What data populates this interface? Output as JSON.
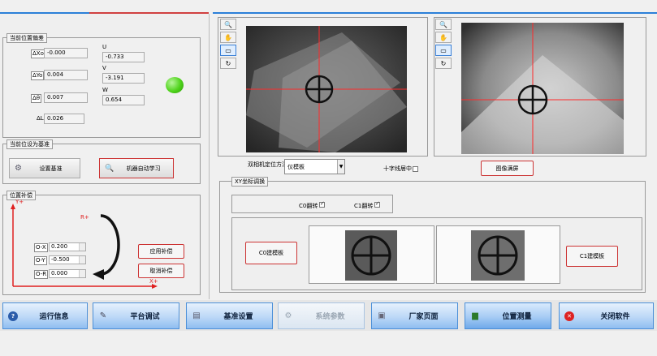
{
  "offset_group": {
    "title": "当前位置偏差",
    "dxo_label": "ΔXo",
    "dxo_value": "-0.000",
    "dyo_label": "ΔYo",
    "dyo_value": "0.004",
    "dtheta_label": "Δθ",
    "dtheta_value": "0.007",
    "dl_label": "ΔL",
    "dl_value": "0.026",
    "u_label": "U",
    "u_value": "-0.733",
    "v_label": "V",
    "v_value": "-3.191",
    "w_label": "W",
    "w_value": "0.654",
    "status_color": "#4ed31a"
  },
  "datum_group": {
    "title": "当前位设为基准",
    "set_datum_label": "设置基准",
    "auto_learn_label": "机器自动学习"
  },
  "comp_group": {
    "title": "位置补偿",
    "y_axis": "Y+",
    "x_axis": "X+",
    "r_label": "R+",
    "ox_label": "O-X",
    "ox_value": "0.200",
    "oy_label": "O-Y",
    "oy_value": "-0.500",
    "or_label": "O-R",
    "or_value": "0.000",
    "apply_label": "应用补偿",
    "cancel_label": "取消补偿"
  },
  "camera_controls": {
    "method_label": "双相机定位方法",
    "method_value": "仪模板",
    "crosshair_label": "十字线居中",
    "fullscreen_label": "图像满屏"
  },
  "xy_group": {
    "title": "XY坐标调换",
    "c0_flip": "C0翻转",
    "c1_flip": "C1翻转",
    "c0_build": "C0建模板",
    "c1_build": "C1建模板"
  },
  "nav": {
    "run_info": "运行信息",
    "platform_debug": "平台调试",
    "datum_setting": "基准设置",
    "system_params": "系统参数",
    "factory_page": "厂家页面",
    "position_measure": "位置测量",
    "close_software": "关闭软件"
  },
  "colors": {
    "accent_blue": "#2b7fd8",
    "button_border_red": "#cc3333",
    "status_green": "#4ed31a"
  }
}
